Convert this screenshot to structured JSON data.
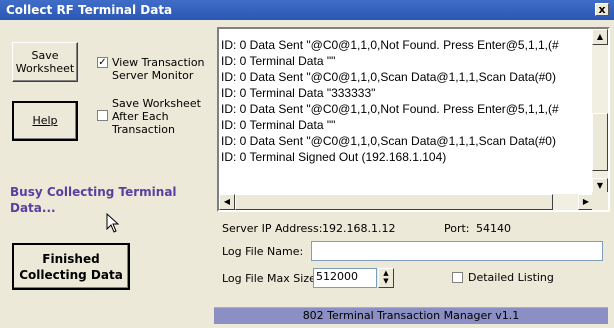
{
  "window": {
    "title": "Collect RF Terminal Data",
    "close_glyph": "x"
  },
  "left": {
    "save_button": "Save\nWorksheet",
    "help_button": "Help",
    "view_monitor": {
      "label": "View Transaction\nServer Monitor",
      "checked": true,
      "mark": "✓"
    },
    "save_after": {
      "label": "Save Worksheet\nAfter Each\nTransaction",
      "checked": false
    },
    "status_text": "Busy Collecting Terminal Data...",
    "finished_button": "Finished\nCollecting Data"
  },
  "log": {
    "lines": [
      "ID: 0 Data Sent \"@C0@1,1,0,Not Found. Press Enter@5,1,1,(#",
      "ID: 0 Terminal Data \"\"",
      "ID: 0 Data Sent \"@C0@1,1,0,Scan Data@1,1,1,Scan Data(#0)",
      "ID: 0 Terminal Data \"333333\"",
      "ID: 0 Data Sent \"@C0@1,1,0,Not Found. Press Enter@5,1,1,(#",
      "ID: 0 Terminal Data \"\"",
      "ID: 0 Data Sent \"@C0@1,1,0,Scan Data@1,1,1,Scan Data(#0)",
      "ID: 0 Terminal Signed Out (192.168.1.104)"
    ]
  },
  "server": {
    "ip_label": "Server IP Address:",
    "ip_value": "192.168.1.12",
    "port_label": "Port:",
    "port_value": "54140",
    "log_file_label": "Log File Name:",
    "log_file_value": "",
    "max_size_label": "Log File Max Size:",
    "max_size_value": "512000",
    "detailed_label": "Detailed Listing",
    "detailed_checked": false
  },
  "footer": "802 Terminal Transaction Manager v1.1"
}
